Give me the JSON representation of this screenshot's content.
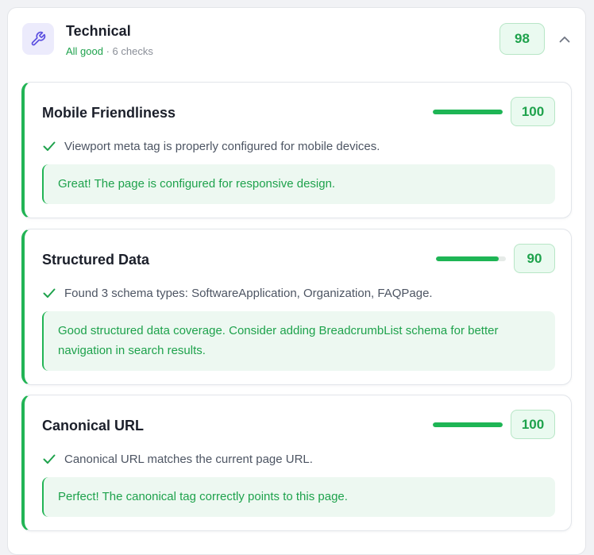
{
  "section": {
    "title": "Technical",
    "status": "All good",
    "separator": " · ",
    "checks_count": "6 checks",
    "score": "98",
    "icon": "wrench-icon",
    "collapse_icon": "chevron-up-icon"
  },
  "checks": [
    {
      "title": "Mobile Friendliness",
      "score": "100",
      "progress_percent": 100,
      "detail": "Viewport meta tag is properly configured for mobile devices.",
      "advice": "Great! The page is configured for responsive design."
    },
    {
      "title": "Structured Data",
      "score": "90",
      "progress_percent": 90,
      "detail": "Found 3 schema types: SoftwareApplication, Organization, FAQPage.",
      "advice": "Good structured data coverage. Consider adding BreadcrumbList schema for better navigation in search results."
    },
    {
      "title": "Canonical URL",
      "score": "100",
      "progress_percent": 100,
      "detail": "Canonical URL matches the current page URL.",
      "advice": "Perfect! The canonical tag correctly points to this page."
    }
  ],
  "colors": {
    "success": "#1ea24c",
    "accent": "#22b455",
    "icon_bg": "#ecebfc",
    "icon_fg": "#5b4fe0"
  }
}
